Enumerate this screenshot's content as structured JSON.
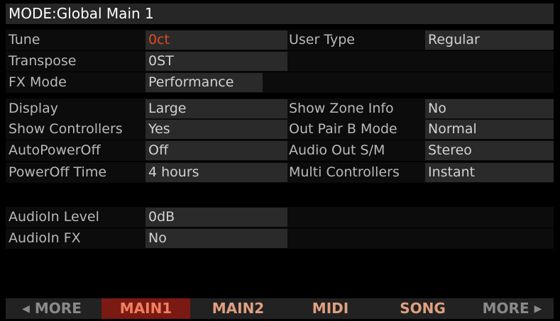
{
  "header": {
    "title": "MODE:Global Main 1"
  },
  "params": {
    "tune": {
      "label": "Tune",
      "value": "0ct"
    },
    "transpose": {
      "label": "Transpose",
      "value": "0ST"
    },
    "fx_mode": {
      "label": "FX Mode",
      "value": "Performance"
    },
    "display": {
      "label": "Display",
      "value": "Large"
    },
    "show_controllers": {
      "label": "Show Controllers",
      "value": "Yes"
    },
    "auto_power_off": {
      "label": "AutoPowerOff",
      "value": "Off"
    },
    "power_off_time": {
      "label": "PowerOff Time",
      "value": "4 hours"
    },
    "audio_in_level": {
      "label": "AudioIn Level",
      "value": "0dB"
    },
    "audio_in_fx": {
      "label": "AudioIn FX",
      "value": "No"
    },
    "user_type": {
      "label": "User Type",
      "value": "Regular"
    },
    "show_zone_info": {
      "label": "Show Zone Info",
      "value": "No"
    },
    "out_pair_b_mode": {
      "label": "Out Pair B Mode",
      "value": "Normal"
    },
    "audio_out_sm": {
      "label": "Audio Out S/M",
      "value": "Stereo"
    },
    "multi_controllers": {
      "label": "Multi Controllers",
      "value": "Instant"
    }
  },
  "tabs": {
    "more_left": {
      "arrow": "◀",
      "label": "MORE"
    },
    "main1": "MAIN1",
    "main2": "MAIN2",
    "midi": "MIDI",
    "song": "SONG",
    "more_right": {
      "arrow": "▶",
      "label": "MORE"
    }
  },
  "colors": {
    "background": "#000000",
    "highlight_value": "#e04a26",
    "active_tab_bg": "#7a1a12",
    "tab_text": "#e0a080"
  }
}
